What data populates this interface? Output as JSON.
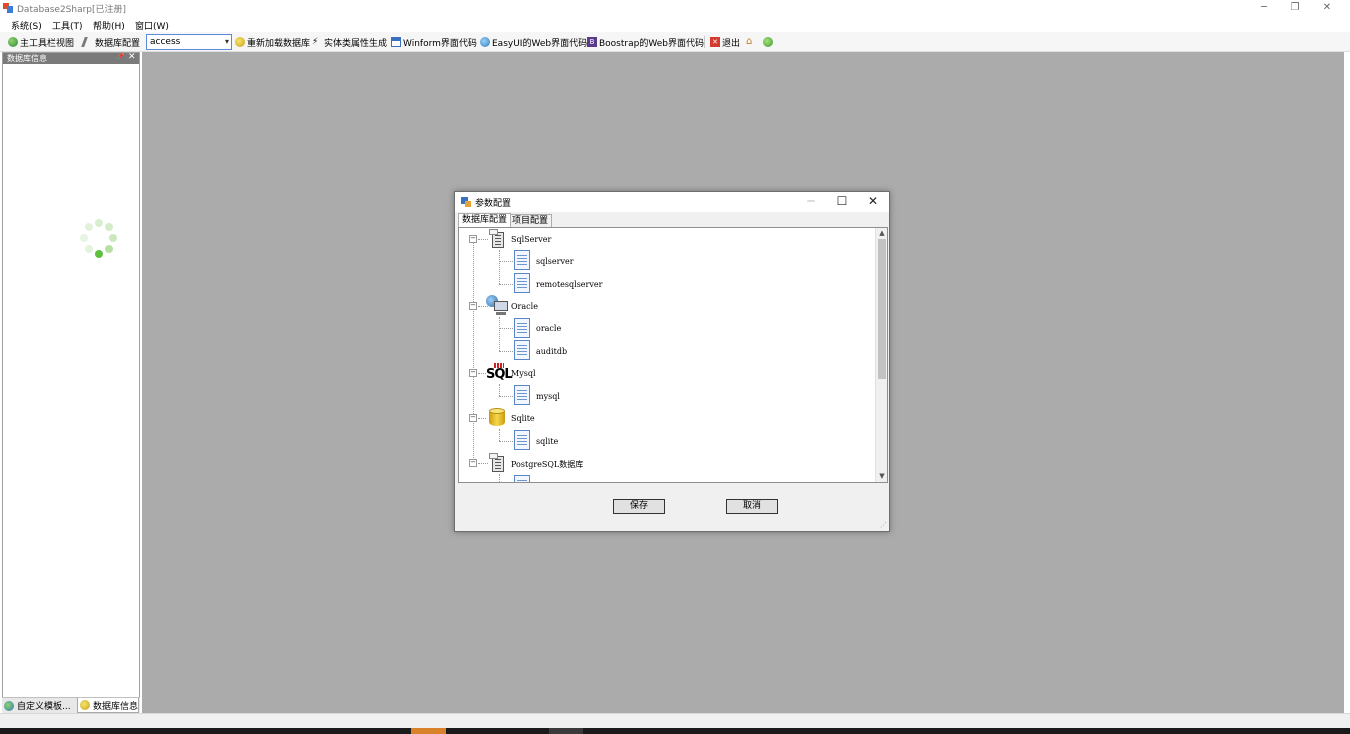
{
  "window": {
    "title": "Database2Sharp[已注册]",
    "controls": [
      "─",
      "❐",
      "✕"
    ]
  },
  "menu": [
    {
      "label": "系统(S)"
    },
    {
      "label": "工具(T)"
    },
    {
      "label": "帮助(H)"
    },
    {
      "label": "窗口(W)"
    }
  ],
  "toolbar": {
    "main_view": "主工具栏视图",
    "db_config": "数据库配置",
    "db_select": "access",
    "reload": "重新加载数据库",
    "entity_gen": "实体类属性生成",
    "winform": "Winform界面代码",
    "easyui": "EasyUI的Web界面代码",
    "bootstrap": "Boostrap的Web界面代码",
    "exit": "退出"
  },
  "left_panel": {
    "title": "数据库信息",
    "pin": "📌",
    "close": "✕",
    "tabs": [
      "自定义模板...",
      "数据库信息"
    ]
  },
  "dialog": {
    "title": "参数配置",
    "controls": [
      "─",
      "☐",
      "✕"
    ],
    "tabs": [
      "数据库配置",
      "项目配置"
    ],
    "tree": [
      {
        "label": "SqlServer",
        "children": [
          "sqlserver",
          "remotesqlserver"
        ]
      },
      {
        "label": "Oracle",
        "children": [
          "oracle",
          "auditdb"
        ]
      },
      {
        "label": "Mysql",
        "children": [
          "mysql"
        ]
      },
      {
        "label": "Sqlite",
        "children": [
          "sqlite"
        ]
      },
      {
        "label": "PostgreSQL数据库",
        "children": []
      }
    ],
    "save_label": "保存",
    "cancel_label": "取消"
  },
  "colors": {
    "accent_border": "#5b8ad8",
    "mdi_background": "#ababab",
    "spinner": "#5fbf3f"
  },
  "icons": {
    "sql_text": "SQL"
  }
}
